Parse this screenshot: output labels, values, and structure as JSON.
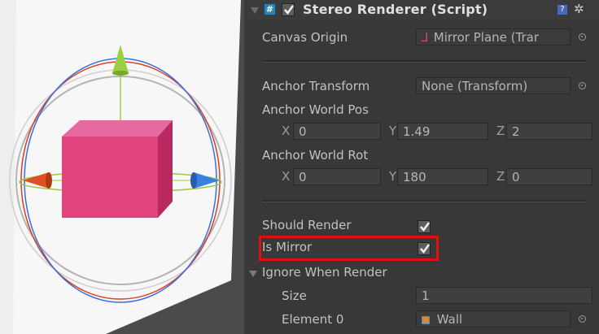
{
  "component": {
    "title": "Stereo Renderer (Script)",
    "enabled": true
  },
  "fields": {
    "canvas_origin": {
      "label": "Canvas Origin",
      "value": "Mirror Plane (Trar"
    },
    "anchor_transform": {
      "label": "Anchor Transform",
      "value": "None (Transform)"
    },
    "anchor_world_pos": {
      "label": "Anchor World Pos",
      "x_label": "X",
      "x": "0",
      "y_label": "Y",
      "y": "1.49",
      "z_label": "Z",
      "z": "2"
    },
    "anchor_world_rot": {
      "label": "Anchor World Rot",
      "x_label": "X",
      "x": "0",
      "y_label": "Y",
      "y": "180",
      "z_label": "Z",
      "z": "0"
    },
    "should_render": {
      "label": "Should Render",
      "checked": true
    },
    "is_mirror": {
      "label": "Is Mirror",
      "checked": true
    },
    "ignore_when_render": {
      "label": "Ignore When Render",
      "size_label": "Size",
      "size": "1",
      "element0_label": "Element 0",
      "element0": "Wall"
    }
  },
  "colors": {
    "highlight": "#e01010",
    "cube": "#e0437e",
    "inspector_bg": "#383838"
  },
  "icons": [
    "script-icon",
    "help-icon",
    "gear-icon",
    "object-picker-icon",
    "transform-icon",
    "cube-icon"
  ]
}
